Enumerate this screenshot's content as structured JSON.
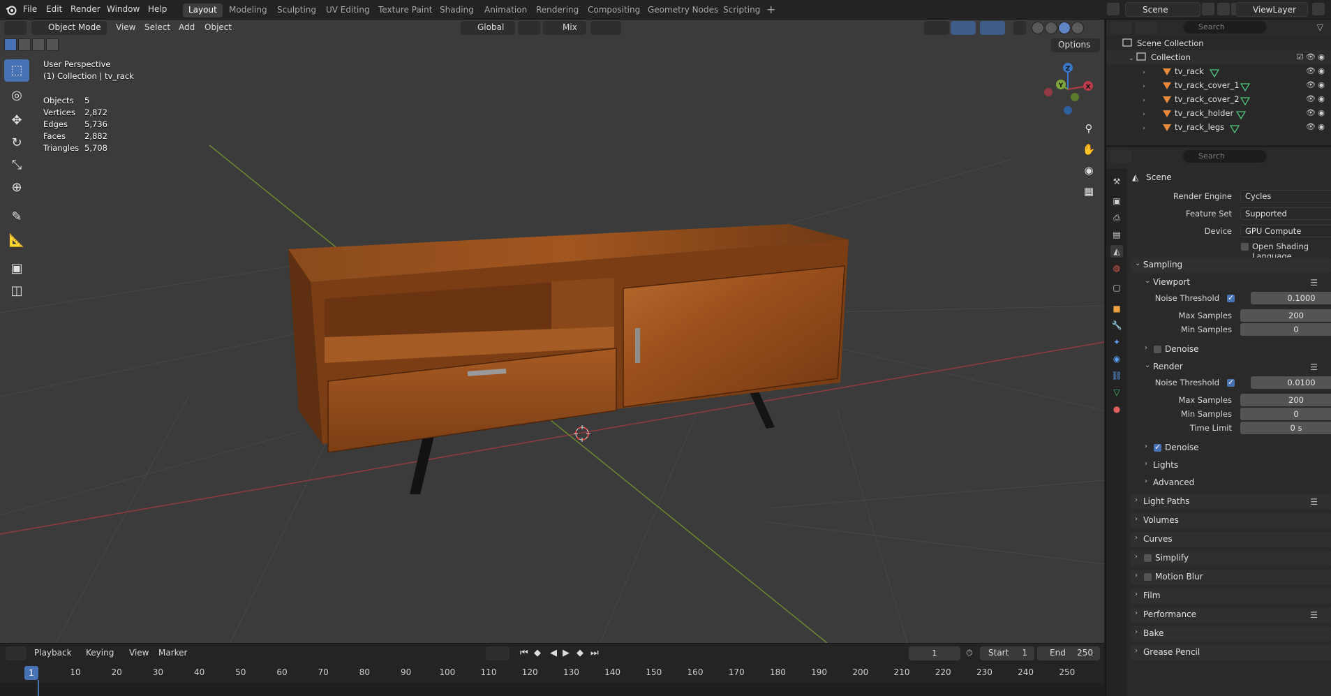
{
  "topbar": {
    "menus": [
      "File",
      "Edit",
      "Render",
      "Window",
      "Help"
    ],
    "workspaces": [
      "Layout",
      "Modeling",
      "Sculpting",
      "UV Editing",
      "Texture Paint",
      "Shading",
      "Animation",
      "Rendering",
      "Compositing",
      "Geometry Nodes",
      "Scripting"
    ],
    "active_workspace": "Layout",
    "scene": "Scene",
    "view_layer": "ViewLayer"
  },
  "viewport": {
    "mode": "Object Mode",
    "menus": [
      "View",
      "Select",
      "Add",
      "Object"
    ],
    "orientation": "Global",
    "snap_mode": "Mix",
    "options_label": "Options",
    "perspective": "User Perspective",
    "collection_info": "(1) Collection | tv_rack",
    "stats": [
      {
        "label": "Objects",
        "value": "5"
      },
      {
        "label": "Vertices",
        "value": "2,872"
      },
      {
        "label": "Edges",
        "value": "5,736"
      },
      {
        "label": "Faces",
        "value": "2,882"
      },
      {
        "label": "Triangles",
        "value": "5,708"
      }
    ],
    "gizmo_axes": {
      "x": "X",
      "y": "Y",
      "z": "Z"
    },
    "colors": {
      "x_axis": "#ba3b4a",
      "y_axis": "#7da53b",
      "z_axis": "#3a78c7",
      "accent": "#4772b3"
    }
  },
  "outliner": {
    "search_placeholder": "Search",
    "root": "Scene Collection",
    "collection": "Collection",
    "objects": [
      "tv_rack",
      "tv_rack_cover_1",
      "tv_rack_cover_2",
      "tv_rack_holder",
      "tv_rack_legs"
    ]
  },
  "properties": {
    "search_placeholder": "Search",
    "title": "Scene",
    "render_engine_label": "Render Engine",
    "render_engine": "Cycles",
    "feature_set_label": "Feature Set",
    "feature_set": "Supported",
    "device_label": "Device",
    "device": "GPU Compute",
    "osl_label": "Open Shading Language",
    "sampling": "Sampling",
    "viewport_label": "Viewport",
    "vp_noise_label": "Noise Threshold",
    "vp_noise": "0.1000",
    "vp_max_label": "Max Samples",
    "vp_max": "200",
    "vp_min_label": "Min Samples",
    "vp_min": "0",
    "vp_denoise": "Denoise",
    "render_label": "Render",
    "r_noise_label": "Noise Threshold",
    "r_noise": "0.0100",
    "r_max_label": "Max Samples",
    "r_max": "200",
    "r_min_label": "Min Samples",
    "r_min": "0",
    "r_time_label": "Time Limit",
    "r_time": "0 s",
    "r_denoise": "Denoise",
    "lights": "Lights",
    "advanced": "Advanced",
    "sections": [
      "Light Paths",
      "Volumes",
      "Curves",
      "Simplify",
      "Motion Blur",
      "Film",
      "Performance",
      "Bake",
      "Grease Pencil"
    ]
  },
  "timeline": {
    "menus": [
      "Playback",
      "Keying",
      "View",
      "Marker"
    ],
    "current_frame": "1",
    "start_label": "Start",
    "start": "1",
    "end_label": "End",
    "end": "250",
    "ticks": [
      "10",
      "20",
      "30",
      "40",
      "50",
      "60",
      "70",
      "80",
      "90",
      "100",
      "110",
      "120",
      "130",
      "140",
      "150",
      "160",
      "170",
      "180",
      "190",
      "200",
      "210",
      "220",
      "230",
      "240",
      "250"
    ],
    "cursor_label": "1"
  }
}
